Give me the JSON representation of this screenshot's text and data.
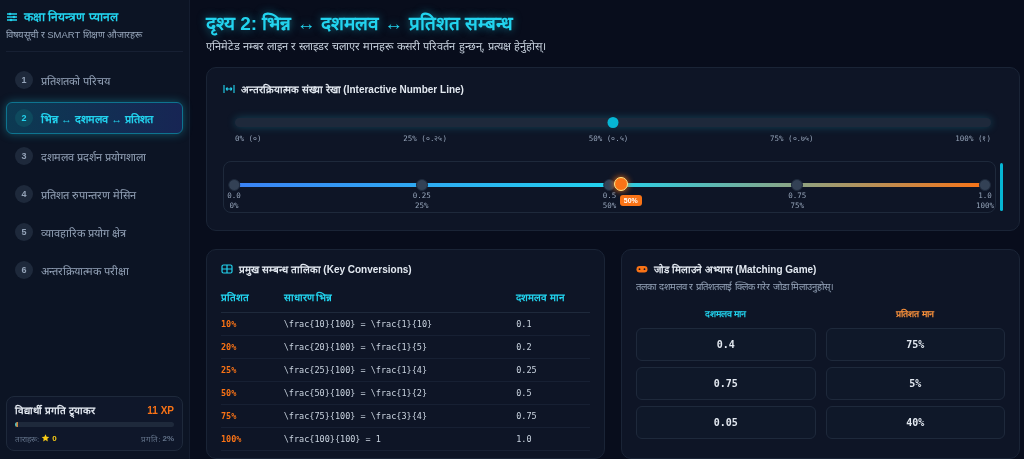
{
  "sidebar": {
    "title": "कक्षा नियन्त्रण प्यानल",
    "subtitle": "विषयसूची र SMART शिक्षण औजारहरू",
    "items": [
      {
        "number": "1",
        "label": "प्रतिशतको परिचय",
        "selected": false
      },
      {
        "number": "2",
        "label": "भिन्न ↔ दशमलव ↔ प्रतिशत",
        "selected": true
      },
      {
        "number": "3",
        "label": "दशमलव प्रदर्शन प्रयोगशाला",
        "selected": false
      },
      {
        "number": "4",
        "label": "प्रतिशत रुपान्तरण मेसिन",
        "selected": false
      },
      {
        "number": "5",
        "label": "व्यावहारिक प्रयोग क्षेत्र",
        "selected": false
      },
      {
        "number": "6",
        "label": "अन्तरक्रियात्मक परीक्षा",
        "selected": false
      }
    ],
    "tracker": {
      "title": "विद्यार्थी प्रगति ट्र्याकर",
      "xp": "11 XP",
      "level": 0.02,
      "stars_label": "ताराहरू:",
      "stars_count": "0",
      "progress": "प्रगति: **2%**"
    }
  },
  "header": {
    "title": "दृश्य 2: भिन्न ↔ दशमलव ↔ प्रतिशत सम्बन्ध",
    "subtitle": "एनिमेटेड नम्बर लाइन र स्लाइडर चलाएर मानहरू कसरी परिवर्तन हुन्छन्, प्रत्यक्ष हेर्नुहोस्।"
  },
  "number_line": {
    "title": "अन्तरक्रियात्मक संख्या रेखा (Interactive Number Line)",
    "slider": {
      "level": 0.5
    },
    "labels": [
      "0% (०)",
      "25% (०.२५)",
      "50% (०.५)",
      "75% (०.७५)",
      "100% (१)"
    ],
    "ticks": [
      {
        "decimal": "0.0",
        "percent": "0%"
      },
      {
        "decimal": "0.25",
        "percent": "25%"
      },
      {
        "decimal": "0.5",
        "percent": "50%"
      },
      {
        "decimal": "0.75",
        "percent": "75%"
      },
      {
        "decimal": "1.0",
        "percent": "100%"
      }
    ],
    "pointer": {
      "level": 0.515,
      "badge": "50%"
    }
  },
  "table": {
    "title": "प्रमुख सम्बन्ध तालिका (Key Conversions)",
    "columns": [
      "प्रतिशत",
      "साधारण भिन्न",
      "दशमलव मान"
    ],
    "rows": [
      [
        "10%",
        "\\frac{10}{100} = \\frac{1}{10}",
        "0.1"
      ],
      [
        "20%",
        "\\frac{20}{100} = \\frac{1}{5}",
        "0.2"
      ],
      [
        "25%",
        "\\frac{25}{100} = \\frac{1}{4}",
        "0.25"
      ],
      [
        "50%",
        "\\frac{50}{100} = \\frac{1}{2}",
        "0.5"
      ],
      [
        "75%",
        "\\frac{75}{100} = \\frac{3}{4}",
        "0.75"
      ],
      [
        "100%",
        "\\frac{100}{100} = 1",
        "1.0"
      ]
    ]
  },
  "matching": {
    "title": "जोड मिलाउने अभ्यास (Matching Game)",
    "subtitle": "तलका दशमलव र प्रतिशतलाई क्लिक गरेर जोडा मिलाउनुहोस्।",
    "columns": [
      {
        "heading": "दशमलव मान",
        "color": "#22d3ee",
        "tiles": [
          "0.4",
          "0.75",
          "0.05"
        ]
      },
      {
        "heading": "प्रतिशत मान",
        "color": "#fb923c",
        "tiles": [
          "75%",
          "5%",
          "40%"
        ]
      }
    ]
  }
}
